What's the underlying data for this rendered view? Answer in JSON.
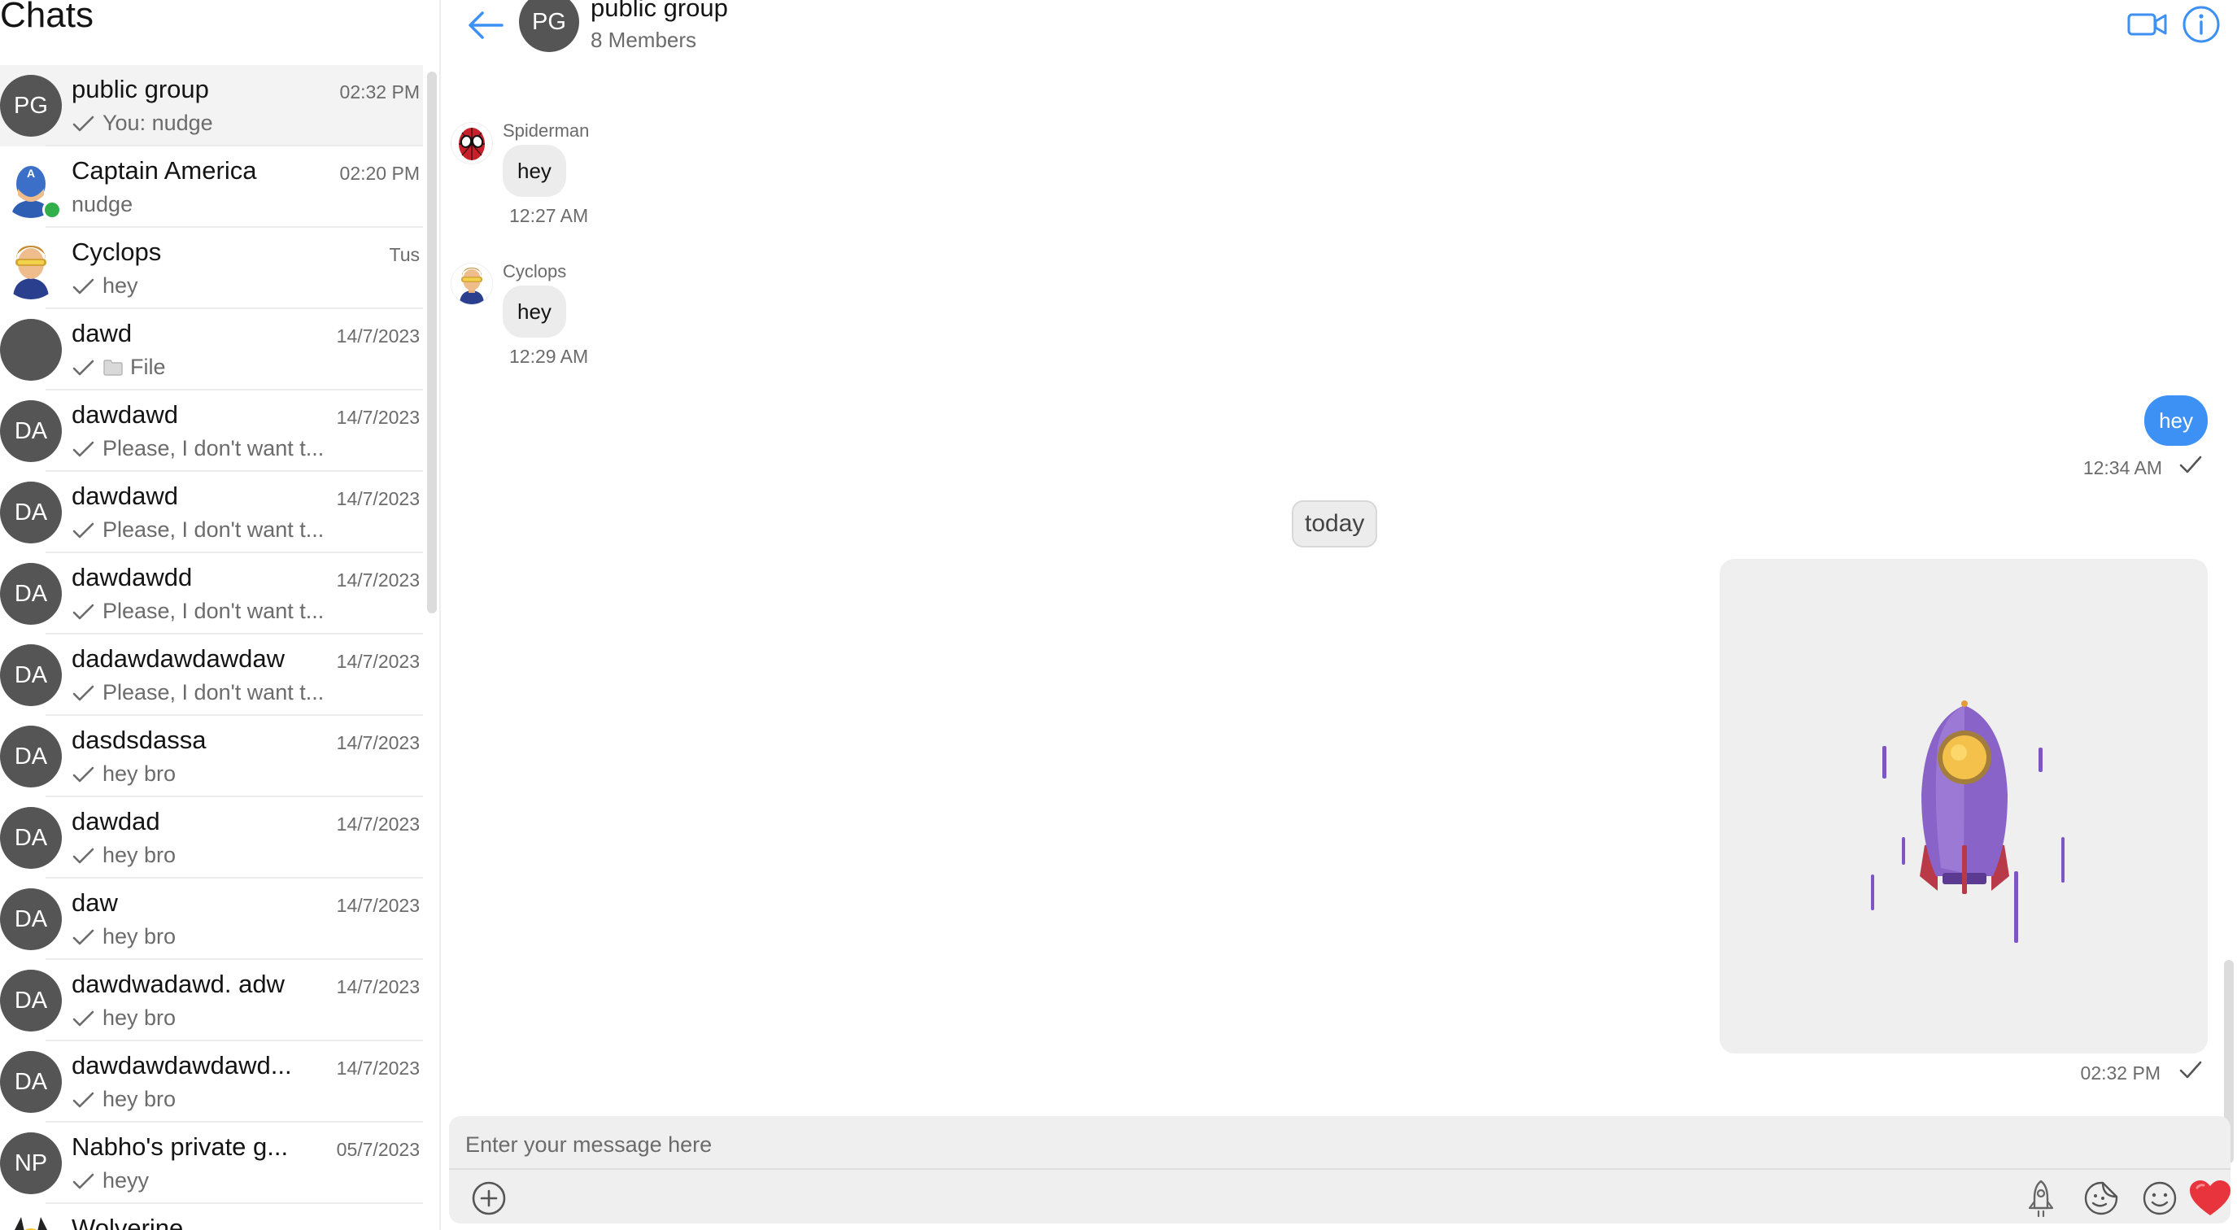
{
  "sidebar": {
    "title": "Chats",
    "items": [
      {
        "name": "public group",
        "time": "02:32 PM",
        "preview": "You: nudge",
        "avatar": "PG",
        "sent_check": true
      },
      {
        "name": "Captain America",
        "time": "02:20 PM",
        "preview": "nudge",
        "avatar": "",
        "online": true
      },
      {
        "name": "Cyclops",
        "time": "Tus",
        "preview": "hey",
        "avatar": "",
        "sent_check": true
      },
      {
        "name": "dawd",
        "time": "14/7/2023",
        "preview": "File",
        "avatar": "",
        "sent_check": true,
        "file_icon": true
      },
      {
        "name": "dawdawd",
        "time": "14/7/2023",
        "preview": "Please, I don't want t...",
        "avatar": "DA",
        "sent_check": true
      },
      {
        "name": "dawdawd",
        "time": "14/7/2023",
        "preview": "Please, I don't want t...",
        "avatar": "DA",
        "sent_check": true
      },
      {
        "name": "dawdawdd",
        "time": "14/7/2023",
        "preview": "Please, I don't want t...",
        "avatar": "DA",
        "sent_check": true
      },
      {
        "name": "dadawdawdawdaw",
        "time": "14/7/2023",
        "preview": "Please, I don't want t...",
        "avatar": "DA",
        "sent_check": true
      },
      {
        "name": "dasdsdassa",
        "time": "14/7/2023",
        "preview": "hey bro",
        "avatar": "DA",
        "sent_check": true
      },
      {
        "name": "dawdad",
        "time": "14/7/2023",
        "preview": "hey bro",
        "avatar": "DA",
        "sent_check": true
      },
      {
        "name": "daw",
        "time": "14/7/2023",
        "preview": "hey bro",
        "avatar": "DA",
        "sent_check": true
      },
      {
        "name": "dawdwadawd. adw",
        "time": "14/7/2023",
        "preview": "hey bro",
        "avatar": "DA",
        "sent_check": true
      },
      {
        "name": "dawdawdawdawd...",
        "time": "14/7/2023",
        "preview": "hey bro",
        "avatar": "DA",
        "sent_check": true
      },
      {
        "name": "Nabho's private g...",
        "time": "05/7/2023",
        "preview": "heyy",
        "avatar": "NP",
        "sent_check": true
      },
      {
        "name": "Wolverine",
        "time": "",
        "preview": "",
        "avatar": ""
      }
    ]
  },
  "header": {
    "avatar": "PG",
    "title": "public group",
    "subtitle": "8 Members"
  },
  "messages": {
    "m1": {
      "sender": "Spiderman",
      "text": "hey",
      "time": "12:27 AM"
    },
    "m2": {
      "sender": "Cyclops",
      "text": "hey",
      "time": "12:29 AM"
    },
    "m3": {
      "text": "hey",
      "time": "12:34 AM"
    },
    "date_separator": "today",
    "m4": {
      "sticker": "rocket-sticker",
      "time": "02:32 PM"
    }
  },
  "composer": {
    "placeholder": "Enter your message here"
  },
  "colors": {
    "accent": "#3d91f5",
    "avatar_bg": "#555555",
    "online": "#31b04a",
    "heart": "#e8343c"
  }
}
